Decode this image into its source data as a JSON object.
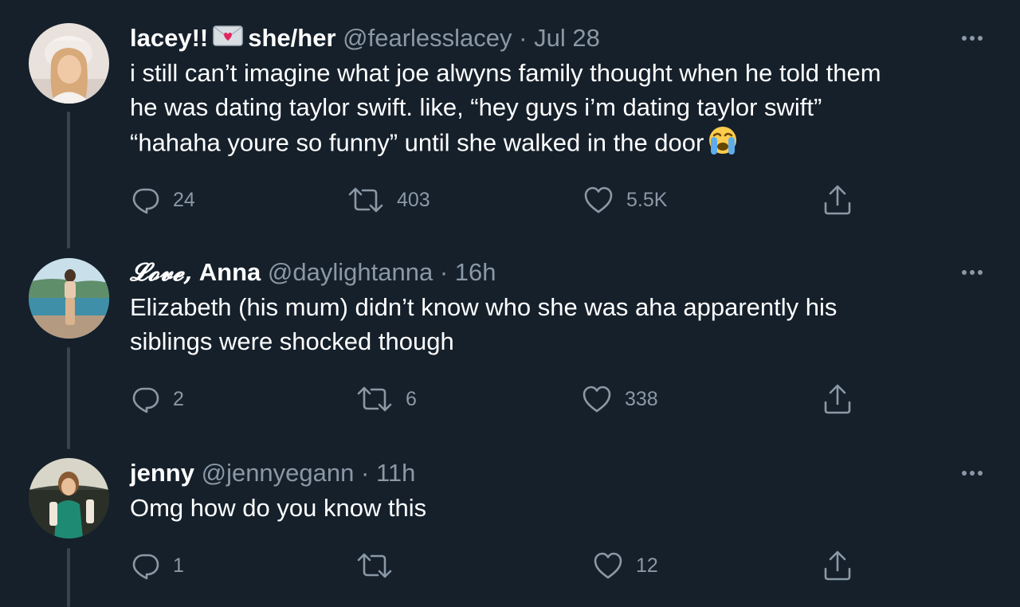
{
  "tweets": [
    {
      "name": "lacey!!",
      "badge_icon": "love-letter-emoji",
      "pronouns": "she/her",
      "handle": "@fearlesslacey",
      "separator": "·",
      "time": "Jul 28",
      "text_lines": [
        "i still can’t imagine what joe alwyns family thought when he told them",
        "he was dating taylor swift. like, “hey guys i’m dating taylor swift”",
        "“hahaha youre so funny” until she walked in the door"
      ],
      "trailing_emoji": "loudly-crying-face-emoji",
      "replies": "24",
      "retweets": "403",
      "likes": "5.5K"
    },
    {
      "name_script": "𝓛𝓸𝓿𝓮,",
      "name": "Anna",
      "handle": "@daylightanna",
      "separator": "·",
      "time": "16h",
      "text_lines": [
        "Elizabeth (his mum) didn’t know who she was aha apparently his",
        "siblings were shocked though"
      ],
      "replies": "2",
      "retweets": "6",
      "likes": "338"
    },
    {
      "name": "jenny",
      "handle": "@jennyegann",
      "separator": "·",
      "time": "11h",
      "text_lines": [
        "Omg how do you know this"
      ],
      "replies": "1",
      "retweets": "",
      "likes": "12"
    }
  ],
  "colors": {
    "background": "#15202b",
    "text_primary": "#ffffff",
    "text_secondary": "#8b98a5",
    "thread_line": "#38444d"
  }
}
